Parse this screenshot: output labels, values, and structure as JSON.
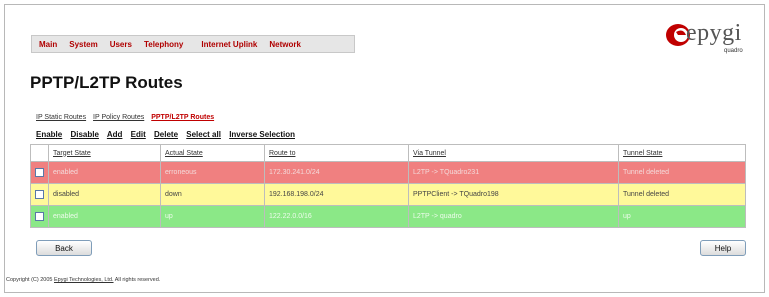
{
  "nav": {
    "items": [
      "Main",
      "System",
      "Users",
      "Telephony",
      "Internet Uplink",
      "Network"
    ]
  },
  "logo": {
    "text": "epygi",
    "subtitle": "quadro"
  },
  "page": {
    "title": "PPTP/L2TP Routes"
  },
  "sublinks": {
    "static": "IP Static Routes",
    "policy": "IP Policy Routes",
    "pptp": "PPTP/L2TP Routes"
  },
  "toolbar": {
    "enable": "Enable",
    "disable": "Disable",
    "add": "Add",
    "edit": "Edit",
    "delete": "Delete",
    "select_all": "Select all",
    "inverse": "Inverse Selection"
  },
  "table": {
    "headers": [
      "Target State",
      "Actual State",
      "Route to",
      "Via Tunnel",
      "Tunnel State"
    ],
    "rows": [
      {
        "target": "enabled",
        "actual": "erroneous",
        "route": "172.30.241.0/24",
        "via": "L2TP -> TQuadro231",
        "tunnel": "Tunnel deleted",
        "color": "#f08080"
      },
      {
        "target": "disabled",
        "actual": "down",
        "route": "192.168.198.0/24",
        "via": "PPTPClient -> TQuadro198",
        "tunnel": "Tunnel deleted",
        "color": "#fff99a"
      },
      {
        "target": "enabled",
        "actual": "up",
        "route": "122.22.0.0/16",
        "via": "L2TP -> quadro",
        "tunnel": "up",
        "color": "#8be887"
      }
    ]
  },
  "buttons": {
    "back": "Back",
    "help": "Help"
  },
  "footer": {
    "prefix": "Copyright (C) 2005",
    "link": "Epygi Technologies, Ltd.",
    "suffix": "All rights reserved."
  },
  "colors": {
    "brand": "#b00000",
    "logo_swoosh": "#c00000"
  }
}
